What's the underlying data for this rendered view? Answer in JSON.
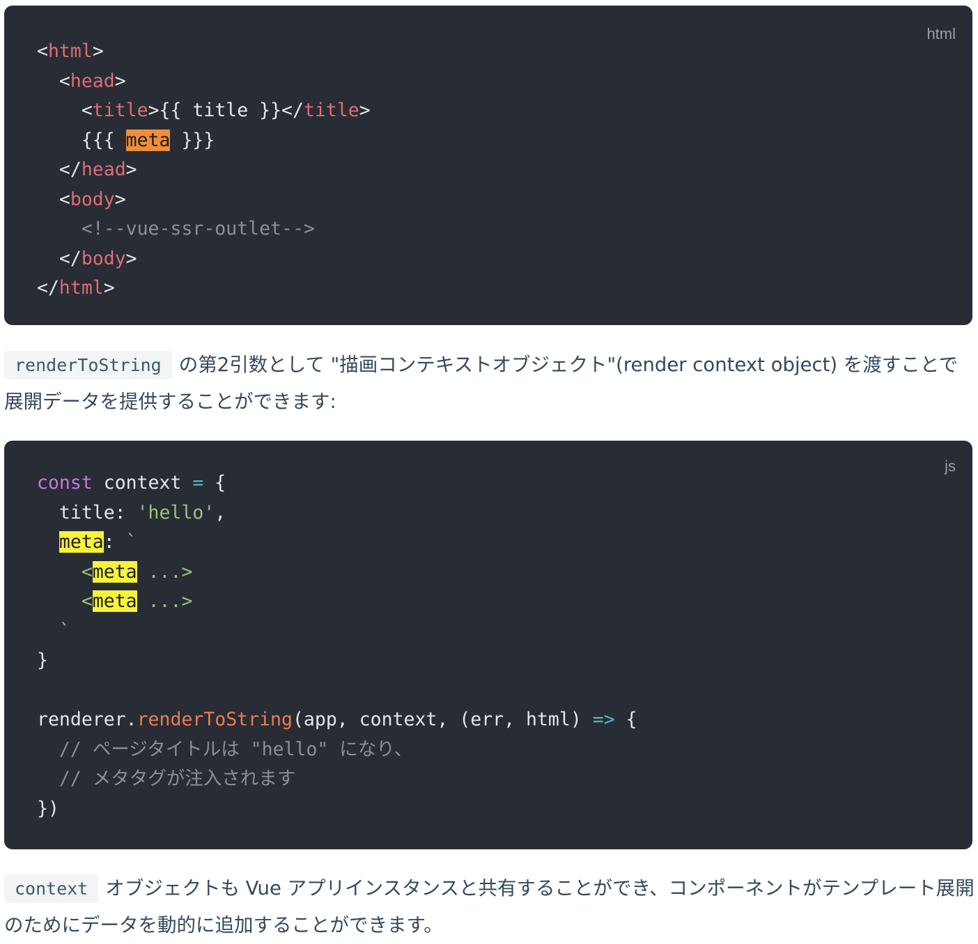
{
  "blocks": {
    "html": {
      "lang": "html",
      "lines": {
        "l1_open": "<",
        "l1_tag": "html",
        "l1_close": ">",
        "l2_open": "<",
        "l2_tag": "head",
        "l2_close": ">",
        "l3_open": "<",
        "l3_tag": "title",
        "l3_mid": ">{{ title }}</",
        "l3_tag2": "title",
        "l3_close": ">",
        "l4_pre": "{{{ ",
        "l4_hl": "meta",
        "l4_post": " }}}",
        "l5_open": "</",
        "l5_tag": "head",
        "l5_close": ">",
        "l6_open": "<",
        "l6_tag": "body",
        "l6_close": ">",
        "l7_comment": "<!--vue-ssr-outlet-->",
        "l8_open": "</",
        "l8_tag": "body",
        "l8_close": ">",
        "l9_open": "</",
        "l9_tag": "html",
        "l9_close": ">"
      }
    },
    "js": {
      "lang": "js",
      "lines": {
        "l1_kw": "const",
        "l1_id": " context ",
        "l1_op": "=",
        "l1_rest": " {",
        "l2_key": "  title: ",
        "l2_str": "'hello'",
        "l2_rest": ",",
        "l3_hl": "meta",
        "l3_colon": ": ",
        "l3_tick": "`",
        "l4_lt": "<",
        "l4_hl": "meta",
        "l4_rest": " ...>",
        "l5_lt": "<",
        "l5_hl": "meta",
        "l5_rest": " ...>",
        "l6_tick": "`",
        "l7": "}",
        "l9_obj": "renderer.",
        "l9_fn": "renderToString",
        "l9_args": "(app, context, (err, html) ",
        "l9_arrow": "=>",
        "l9_rest": " {",
        "l10_comment": "  // ページタイトルは \"hello\" になり、",
        "l11_comment": "  // メタタグが注入されます",
        "l12": "})"
      }
    }
  },
  "para1": {
    "code": "renderToString",
    "text": "の第2引数として \"描画コンテキストオブジェクト\"(render context object) を渡すことで展開データを提供することができます:"
  },
  "para2": {
    "code": "context",
    "text": "オブジェクトも Vue アプリインスタンスと共有することができ、コンポーネントがテンプレート展開のためにデータを動的に追加することができます。"
  }
}
